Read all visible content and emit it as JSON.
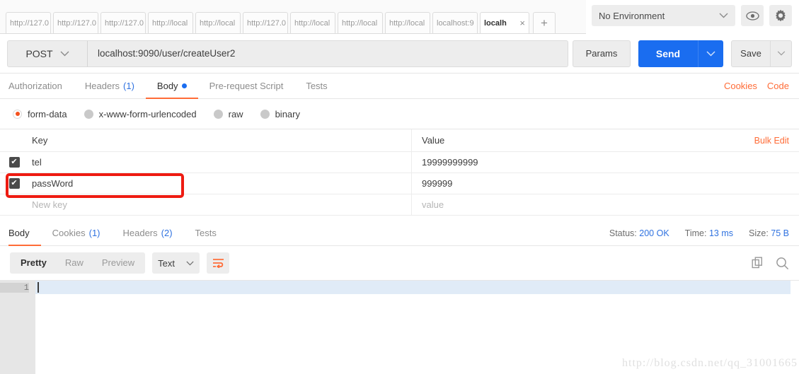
{
  "tabstrip": {
    "tabs": [
      {
        "label": "http://127.0"
      },
      {
        "label": "http://127.0"
      },
      {
        "label": "http://127.0"
      },
      {
        "label": "http://local"
      },
      {
        "label": "http://local"
      },
      {
        "label": "http://127.0"
      },
      {
        "label": "http://local"
      },
      {
        "label": "http://local"
      },
      {
        "label": "http://local"
      },
      {
        "label": "localhost:9"
      },
      {
        "label": "localh"
      }
    ],
    "active_index": 10,
    "close_glyph": "×",
    "add_glyph": "+"
  },
  "environment": {
    "selected": "No Environment",
    "eye_icon": "eye-icon",
    "gear_icon": "gear-icon"
  },
  "request": {
    "method": "POST",
    "url": "localhost:9090/user/createUser2",
    "params_label": "Params",
    "send_label": "Send",
    "save_label": "Save"
  },
  "request_tabs": {
    "items": [
      {
        "label": "Authorization",
        "count": "",
        "dot": false,
        "active": false
      },
      {
        "label": "Headers",
        "count": "(1)",
        "dot": false,
        "active": false
      },
      {
        "label": "Body",
        "count": "",
        "dot": true,
        "active": true
      },
      {
        "label": "Pre-request Script",
        "count": "",
        "dot": false,
        "active": false
      },
      {
        "label": "Tests",
        "count": "",
        "dot": false,
        "active": false
      }
    ],
    "cookies_label": "Cookies",
    "code_label": "Code"
  },
  "body_types": [
    {
      "label": "form-data",
      "selected": true
    },
    {
      "label": "x-www-form-urlencoded",
      "selected": false
    },
    {
      "label": "raw",
      "selected": false
    },
    {
      "label": "binary",
      "selected": false
    }
  ],
  "form_table": {
    "header": {
      "key": "Key",
      "value": "Value",
      "bulk_edit": "Bulk Edit"
    },
    "rows": [
      {
        "checked": true,
        "key": "tel",
        "value": "19999999999",
        "placeholder": false,
        "highlighted": false
      },
      {
        "checked": true,
        "key": "passWord",
        "value": "999999",
        "placeholder": false,
        "highlighted": true
      },
      {
        "checked": false,
        "key": "New key",
        "value": "value",
        "placeholder": true,
        "highlighted": false
      }
    ],
    "check_glyph": "✔",
    "highlight_color": "#ee1b11"
  },
  "response_tabs": {
    "items": [
      {
        "label": "Body",
        "count": "",
        "active": true
      },
      {
        "label": "Cookies",
        "count": "(1)",
        "active": false
      },
      {
        "label": "Headers",
        "count": "(2)",
        "active": false
      },
      {
        "label": "Tests",
        "count": "",
        "active": false
      }
    ],
    "status_label": "Status:",
    "status_value": "200 OK",
    "time_label": "Time:",
    "time_value": "13 ms",
    "size_label": "Size:",
    "size_value": "75 B"
  },
  "response_toolbar": {
    "views": [
      {
        "label": "Pretty",
        "active": true
      },
      {
        "label": "Raw",
        "active": false
      },
      {
        "label": "Preview",
        "active": false
      }
    ],
    "format": "Text",
    "wrap_icon": "word-wrap-icon",
    "copy_icon": "copy-icon",
    "search_icon": "search-icon"
  },
  "editor": {
    "line_numbers": [
      "1"
    ],
    "content": ""
  },
  "watermark": "http://blog.csdn.net/qq_31001665"
}
